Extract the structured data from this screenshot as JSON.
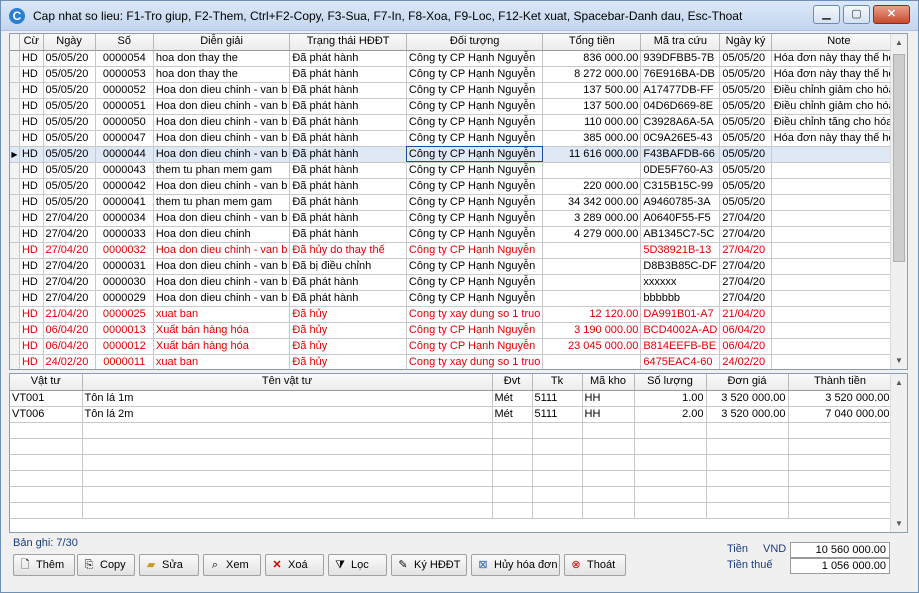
{
  "window": {
    "title": "Cap nhat so lieu: F1-Tro giup, F2-Them, Ctrl+F2-Copy, F3-Sua, F7-In, F8-Xoa, F9-Loc, F12-Ket xuat, Spacebar-Danh dau, Esc-Thoat"
  },
  "invoice_grid": {
    "columns": [
      "Cừ",
      "Ngày",
      "Số",
      "Diễn giải",
      "Trạng thái HĐĐT",
      "Đối tượng",
      "Tổng tiền",
      "Mã tra cứu",
      "Ngày ký",
      "Note"
    ],
    "rows": [
      {
        "cu": "HD",
        "ngay": "05/05/20",
        "so": "0000054",
        "dien_giai": "hoa don thay the",
        "trang_thai": "Đã phát hành",
        "doi_tuong": "Công ty CP Hạnh Nguyễn",
        "tong_tien": "836 000.00",
        "ma_tra_cuu": "939DFBB5-7B",
        "ngay_ky": "05/05/20",
        "note": "Hóa đơn này thay thế hóa",
        "red": false
      },
      {
        "cu": "HD",
        "ngay": "05/05/20",
        "so": "0000053",
        "dien_giai": "hoa don thay the",
        "trang_thai": "Đã phát hành",
        "doi_tuong": "Công ty CP Hạnh Nguyễn",
        "tong_tien": "8 272 000.00",
        "ma_tra_cuu": "76E916BA-DB",
        "ngay_ky": "05/05/20",
        "note": "Hóa đơn này thay thế hóa",
        "red": false
      },
      {
        "cu": "HD",
        "ngay": "05/05/20",
        "so": "0000052",
        "dien_giai": "Hoa don dieu chinh - van b",
        "trang_thai": "Đã phát hành",
        "doi_tuong": "Công ty CP Hạnh Nguyễn",
        "tong_tien": "137 500.00",
        "ma_tra_cuu": "A17477DB-FF",
        "ngay_ky": "05/05/20",
        "note": "Điều chỉnh giảm cho hóa đ",
        "red": false
      },
      {
        "cu": "HD",
        "ngay": "05/05/20",
        "so": "0000051",
        "dien_giai": "Hoa don dieu chinh - van b",
        "trang_thai": "Đã phát hành",
        "doi_tuong": "Công ty CP Hạnh Nguyễn",
        "tong_tien": "137 500.00",
        "ma_tra_cuu": "04D6D669-8E",
        "ngay_ky": "05/05/20",
        "note": "Điều chỉnh giảm cho hóa đ",
        "red": false
      },
      {
        "cu": "HD",
        "ngay": "05/05/20",
        "so": "0000050",
        "dien_giai": "Hoa don dieu chinh - van b",
        "trang_thai": "Đã phát hành",
        "doi_tuong": "Công ty CP Hạnh Nguyễn",
        "tong_tien": "110 000.00",
        "ma_tra_cuu": "C3928A6A-5A",
        "ngay_ky": "05/05/20",
        "note": "Điều chỉnh tăng cho hóa đ",
        "red": false
      },
      {
        "cu": "HD",
        "ngay": "05/05/20",
        "so": "0000047",
        "dien_giai": "Hoa don dieu chinh - van b",
        "trang_thai": "Đã phát hành",
        "doi_tuong": "Công ty CP Hạnh Nguyễn",
        "tong_tien": "385 000.00",
        "ma_tra_cuu": "0C9A26E5-43",
        "ngay_ky": "05/05/20",
        "note": "Hóa đơn này thay thế hóa",
        "red": false
      },
      {
        "cu": "HD",
        "ngay": "05/05/20",
        "so": "0000044",
        "dien_giai": "Hoa don dieu chinh - van b",
        "trang_thai": "Đã phát hành",
        "doi_tuong": "Công ty CP Hạnh Nguyễn",
        "tong_tien": "11 616 000.00",
        "ma_tra_cuu": "F43BAFDB-66",
        "ngay_ky": "05/05/20",
        "note": "",
        "red": false,
        "selected": true
      },
      {
        "cu": "HD",
        "ngay": "05/05/20",
        "so": "0000043",
        "dien_giai": "them tu phan mem gam",
        "trang_thai": "Đã phát hành",
        "doi_tuong": "Công ty CP Hạnh Nguyễn",
        "tong_tien": "",
        "ma_tra_cuu": "0DE5F760-A3",
        "ngay_ky": "05/05/20",
        "note": "",
        "red": false
      },
      {
        "cu": "HD",
        "ngay": "05/05/20",
        "so": "0000042",
        "dien_giai": "Hoa don dieu chinh - van b",
        "trang_thai": "Đã phát hành",
        "doi_tuong": "Công ty CP Hạnh Nguyễn",
        "tong_tien": "220 000.00",
        "ma_tra_cuu": "C315B15C-99",
        "ngay_ky": "05/05/20",
        "note": "",
        "red": false
      },
      {
        "cu": "HD",
        "ngay": "05/05/20",
        "so": "0000041",
        "dien_giai": "them tu phan mem gam",
        "trang_thai": "Đã phát hành",
        "doi_tuong": "Công ty CP Hạnh Nguyễn",
        "tong_tien": "34 342 000.00",
        "ma_tra_cuu": "A9460785-3A",
        "ngay_ky": "05/05/20",
        "note": "",
        "red": false
      },
      {
        "cu": "HD",
        "ngay": "27/04/20",
        "so": "0000034",
        "dien_giai": "Hoa don dieu chinh - van b",
        "trang_thai": "Đã phát hành",
        "doi_tuong": "Công ty CP Hạnh Nguyễn",
        "tong_tien": "3 289 000.00",
        "ma_tra_cuu": "A0640F55-F5",
        "ngay_ky": "27/04/20",
        "note": "",
        "red": false
      },
      {
        "cu": "HD",
        "ngay": "27/04/20",
        "so": "0000033",
        "dien_giai": "Hoa don dieu chinh",
        "trang_thai": "Đã phát hành",
        "doi_tuong": "Công ty CP Hạnh Nguyễn",
        "tong_tien": "4 279 000.00",
        "ma_tra_cuu": "AB1345C7-5C",
        "ngay_ky": "27/04/20",
        "note": "",
        "red": false
      },
      {
        "cu": "HD",
        "ngay": "27/04/20",
        "so": "0000032",
        "dien_giai": "Hoa don dieu chinh - van b",
        "trang_thai": "Đã hủy do thay thế",
        "doi_tuong": "Công ty CP Hạnh Nguyễn",
        "tong_tien": "",
        "ma_tra_cuu": "5D38921B-13",
        "ngay_ky": "27/04/20",
        "note": "",
        "red": true
      },
      {
        "cu": "HD",
        "ngay": "27/04/20",
        "so": "0000031",
        "dien_giai": "Hoa don dieu chinh - van b",
        "trang_thai": "Đã bị điều chỉnh",
        "doi_tuong": "Công ty CP Hạnh Nguyễn",
        "tong_tien": "",
        "ma_tra_cuu": "D8B3B85C-DF",
        "ngay_ky": "27/04/20",
        "note": "",
        "red": false
      },
      {
        "cu": "HD",
        "ngay": "27/04/20",
        "so": "0000030",
        "dien_giai": "Hoa don dieu chinh - van b",
        "trang_thai": "Đã phát hành",
        "doi_tuong": "Công ty CP Hạnh Nguyễn",
        "tong_tien": "",
        "ma_tra_cuu": "xxxxxx",
        "ngay_ky": "27/04/20",
        "note": "",
        "red": false
      },
      {
        "cu": "HD",
        "ngay": "27/04/20",
        "so": "0000029",
        "dien_giai": "Hoa don dieu chinh - van b",
        "trang_thai": "Đã phát hành",
        "doi_tuong": "Công ty CP Hạnh Nguyễn",
        "tong_tien": "",
        "ma_tra_cuu": "bbbbbb",
        "ngay_ky": "27/04/20",
        "note": "",
        "red": false
      },
      {
        "cu": "HD",
        "ngay": "21/04/20",
        "so": "0000025",
        "dien_giai": "xuat ban",
        "trang_thai": "Đã hủy",
        "doi_tuong": "Cong ty xay dung so 1 truo",
        "tong_tien": "12 120.00",
        "ma_tra_cuu": "DA991B01-A7",
        "ngay_ky": "21/04/20",
        "note": "",
        "red": true
      },
      {
        "cu": "HD",
        "ngay": "06/04/20",
        "so": "0000013",
        "dien_giai": "Xuất bán hàng hóa",
        "trang_thai": "Đã hủy",
        "doi_tuong": "Công ty CP Hạnh Nguyễn",
        "tong_tien": "3 190 000.00",
        "ma_tra_cuu": "BCD4002A-AD",
        "ngay_ky": "06/04/20",
        "note": "",
        "red": true
      },
      {
        "cu": "HD",
        "ngay": "06/04/20",
        "so": "0000012",
        "dien_giai": "Xuất bán hàng hóa",
        "trang_thai": "Đã hủy",
        "doi_tuong": "Công ty CP Hạnh Nguyễn",
        "tong_tien": "23 045 000.00",
        "ma_tra_cuu": "B814EEFB-BE",
        "ngay_ky": "06/04/20",
        "note": "",
        "red": true
      },
      {
        "cu": "HD",
        "ngay": "24/02/20",
        "so": "0000011",
        "dien_giai": "xuat ban",
        "trang_thai": "Đã hủy",
        "doi_tuong": "Cong ty xay dung so 1 truo",
        "tong_tien": "",
        "ma_tra_cuu": "6475EAC4-60",
        "ngay_ky": "24/02/20",
        "note": "",
        "red": true
      }
    ]
  },
  "detail_grid": {
    "columns": [
      "Vật tư",
      "Tên vật tư",
      "Đvt",
      "Tk",
      "Mã kho",
      "Số lượng",
      "Đơn giá",
      "Thành tiền"
    ],
    "rows": [
      {
        "vat_tu": "VT001",
        "ten": "Tôn lá 1m",
        "dvt": "Mét",
        "tk": "5111",
        "ma_kho": "HH",
        "so_luong": "1.00",
        "don_gia": "3 520 000.00",
        "thanh_tien": "3 520 000.00"
      },
      {
        "vat_tu": "VT006",
        "ten": "Tôn lá 2m",
        "dvt": "Mét",
        "tk": "5111",
        "ma_kho": "HH",
        "so_luong": "2.00",
        "don_gia": "3 520 000.00",
        "thanh_tien": "7 040 000.00"
      }
    ],
    "empty_rows": 6
  },
  "footer": {
    "record_info": "Bản ghi: 7/30",
    "buttons": {
      "them": "Thêm",
      "copy": "Copy",
      "sua": "Sửa",
      "xem": "Xem",
      "xoa": "Xoá",
      "loc": "Lọc",
      "ky": "Ký HĐĐT",
      "huy": "Hủy hóa đơn",
      "thoat": "Thoát"
    },
    "totals": {
      "tien_label": "Tiền",
      "currency": "VND",
      "tien_value": "10 560 000.00",
      "thue_label": "Tiền thuế",
      "thue_value": "1 056 000.00"
    }
  },
  "colors": {
    "red_row": "#e00000",
    "selected_row": "#dfe8f5",
    "label_blue": "#1a3d7c"
  }
}
